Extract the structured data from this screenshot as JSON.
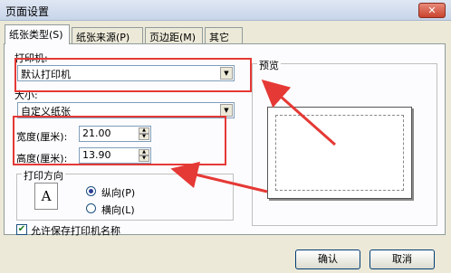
{
  "window": {
    "title": "页面设置",
    "close_glyph": "✕"
  },
  "tabs": [
    {
      "label": "纸张类型(S)",
      "active": true
    },
    {
      "label": "纸张来源(P)",
      "active": false
    },
    {
      "label": "页边距(M)",
      "active": false
    },
    {
      "label": "其它",
      "active": false
    }
  ],
  "printer": {
    "label": "打印机:",
    "value": "默认打印机"
  },
  "size": {
    "label": "大小:",
    "value": "自定义纸张"
  },
  "width": {
    "label": "宽度(厘米):",
    "value": "21.00"
  },
  "height": {
    "label": "高度(厘米):",
    "value": "13.90"
  },
  "orientation": {
    "label": "打印方向",
    "icon_letter": "A",
    "options": [
      {
        "label": "纵向(P)",
        "selected": true
      },
      {
        "label": "横向(L)",
        "selected": false
      }
    ]
  },
  "preview": {
    "label": "预览"
  },
  "allow_save": {
    "label": "允许保存打印机名称",
    "checked": true,
    "check_glyph": "✔"
  },
  "buttons": {
    "ok": "确认",
    "cancel": "取消"
  },
  "annotation_color": "#e53935"
}
